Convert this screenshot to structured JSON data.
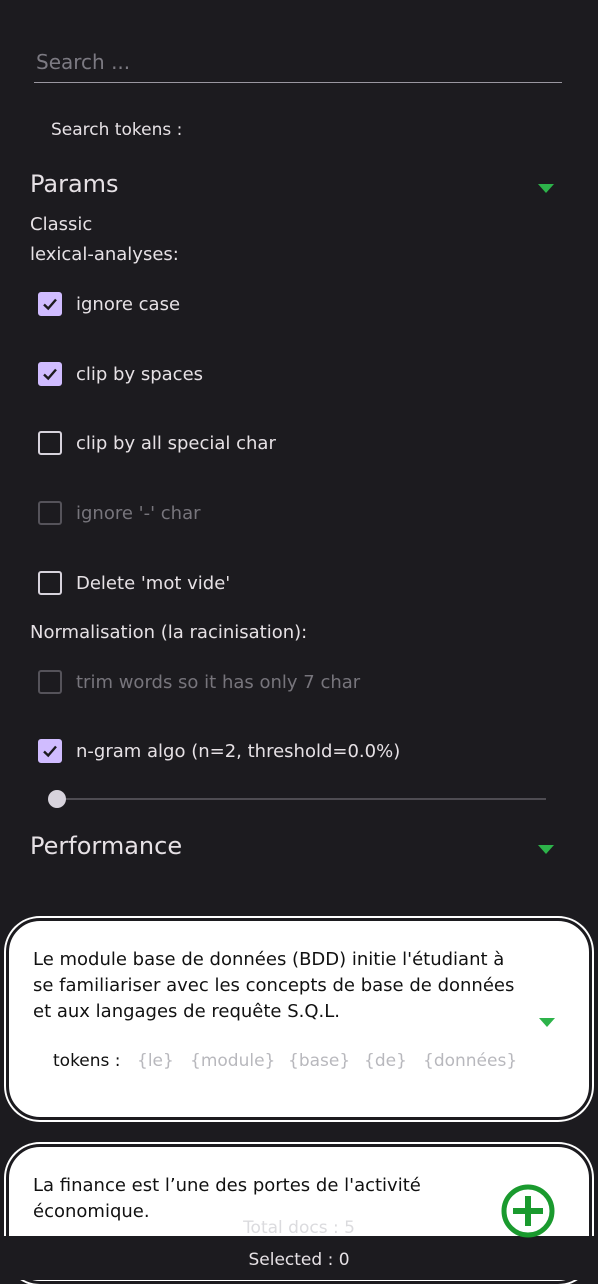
{
  "search": {
    "placeholder": "Search ...",
    "value": "",
    "tokens_label": "Search tokens :"
  },
  "params": {
    "title": "Params",
    "classic_label": "Classic\nlexical-analyses:",
    "options": [
      {
        "label": "ignore case",
        "checked": true,
        "enabled": true
      },
      {
        "label": "clip by spaces",
        "checked": true,
        "enabled": true
      },
      {
        "label": "clip by all special char",
        "checked": false,
        "enabled": true
      },
      {
        "label": "ignore '-' char",
        "checked": false,
        "enabled": false
      },
      {
        "label": "Delete 'mot vide'",
        "checked": false,
        "enabled": true
      }
    ],
    "normalisation_label": "Normalisation (la racinisation):",
    "norm_options": [
      {
        "label": "trim words so it has only 7 char",
        "checked": false,
        "enabled": false
      },
      {
        "label": "n-gram algo (n=2, threshold=0.0%)",
        "checked": true,
        "enabled": true
      }
    ],
    "threshold_fraction": 0.0
  },
  "performance": {
    "title": "Performance"
  },
  "documents": [
    {
      "text": "Le module base de données (BDD) initie l'étudiant à se familiariser avec les concepts de base de données et aux langages de requête S.Q.L.",
      "tokens_label": "tokens :",
      "tokens": [
        "{le}",
        "{module}",
        "{base}",
        "{de}",
        "{données}"
      ]
    },
    {
      "text": "La finance est l’une des portes de l'activité économique."
    }
  ],
  "footer": {
    "total_docs": "Total docs : 5",
    "selected": "Selected : 0"
  },
  "colors": {
    "accent_green": "#2db34a",
    "check_purple": "#d0bcff",
    "background": "#1c1b1f"
  }
}
